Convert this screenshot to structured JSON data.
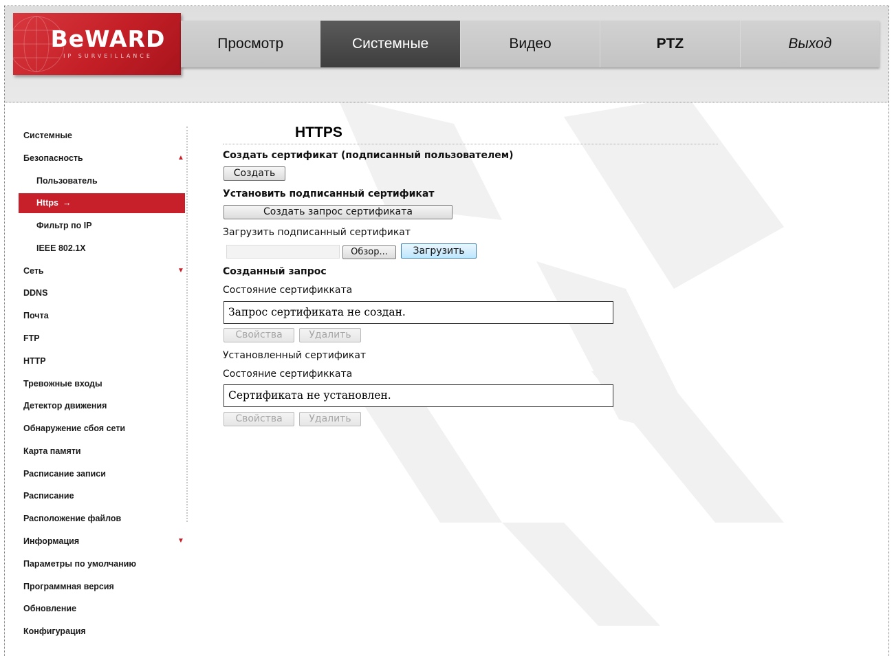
{
  "brand": {
    "name": "BeWARD",
    "tagline": "IP SURVEILLANCE"
  },
  "topnav": [
    {
      "label": "Просмотр"
    },
    {
      "label": "Системные"
    },
    {
      "label": "Видео"
    },
    {
      "label": "PTZ"
    },
    {
      "label": "Выход"
    }
  ],
  "sidebar": {
    "items": [
      {
        "label": "Системные"
      },
      {
        "label": "Безопасность"
      },
      {
        "label": "Пользователь"
      },
      {
        "label": "Https",
        "arrow": "→"
      },
      {
        "label": "Фильтр по IP"
      },
      {
        "label": "IEEE 802.1X"
      },
      {
        "label": "Сеть"
      },
      {
        "label": "DDNS"
      },
      {
        "label": "Почта"
      },
      {
        "label": "FTP"
      },
      {
        "label": "HTTP"
      },
      {
        "label": "Тревожные входы"
      },
      {
        "label": "Детектор движения"
      },
      {
        "label": "Обнаружение сбоя сети"
      },
      {
        "label": "Карта памяти"
      },
      {
        "label": "Расписание записи"
      },
      {
        "label": "Расписание"
      },
      {
        "label": "Расположение файлов"
      },
      {
        "label": "Информация"
      },
      {
        "label": "Параметры по умолчанию"
      },
      {
        "label": "Программная версия"
      },
      {
        "label": "Обновление"
      },
      {
        "label": "Конфигурация"
      }
    ],
    "expand_glyph_up": "▲",
    "expand_glyph_down": "▼"
  },
  "main": {
    "title": "HTTPS",
    "create_cert_heading": "Создать сертификат (подписанный пользователем)",
    "create_button": "Создать",
    "install_signed_heading": "Установить подписанный сертификат",
    "create_request_button": "Создать запрос сертификата",
    "upload_label": "Загрузить подписанный сертификат",
    "browse_button": "Обзор...",
    "upload_button": "Загрузить",
    "created_request_heading": "Созданный запрос",
    "request_state_label": "Состояние сертификката",
    "request_state_value": "Запрос сертификата не создан.",
    "request_properties_button": "Свойства",
    "request_delete_button": "Удалить",
    "installed_heading": "Установленный сертификат",
    "installed_state_label": "Состояние сертификката",
    "installed_state_value": "Сертификата не установлен.",
    "installed_properties_button": "Свойства",
    "installed_delete_button": "Удалить"
  },
  "colors": {
    "accent": "#c8202a",
    "header_bg": "#dedede",
    "active_tab": "#4a4a4a"
  }
}
